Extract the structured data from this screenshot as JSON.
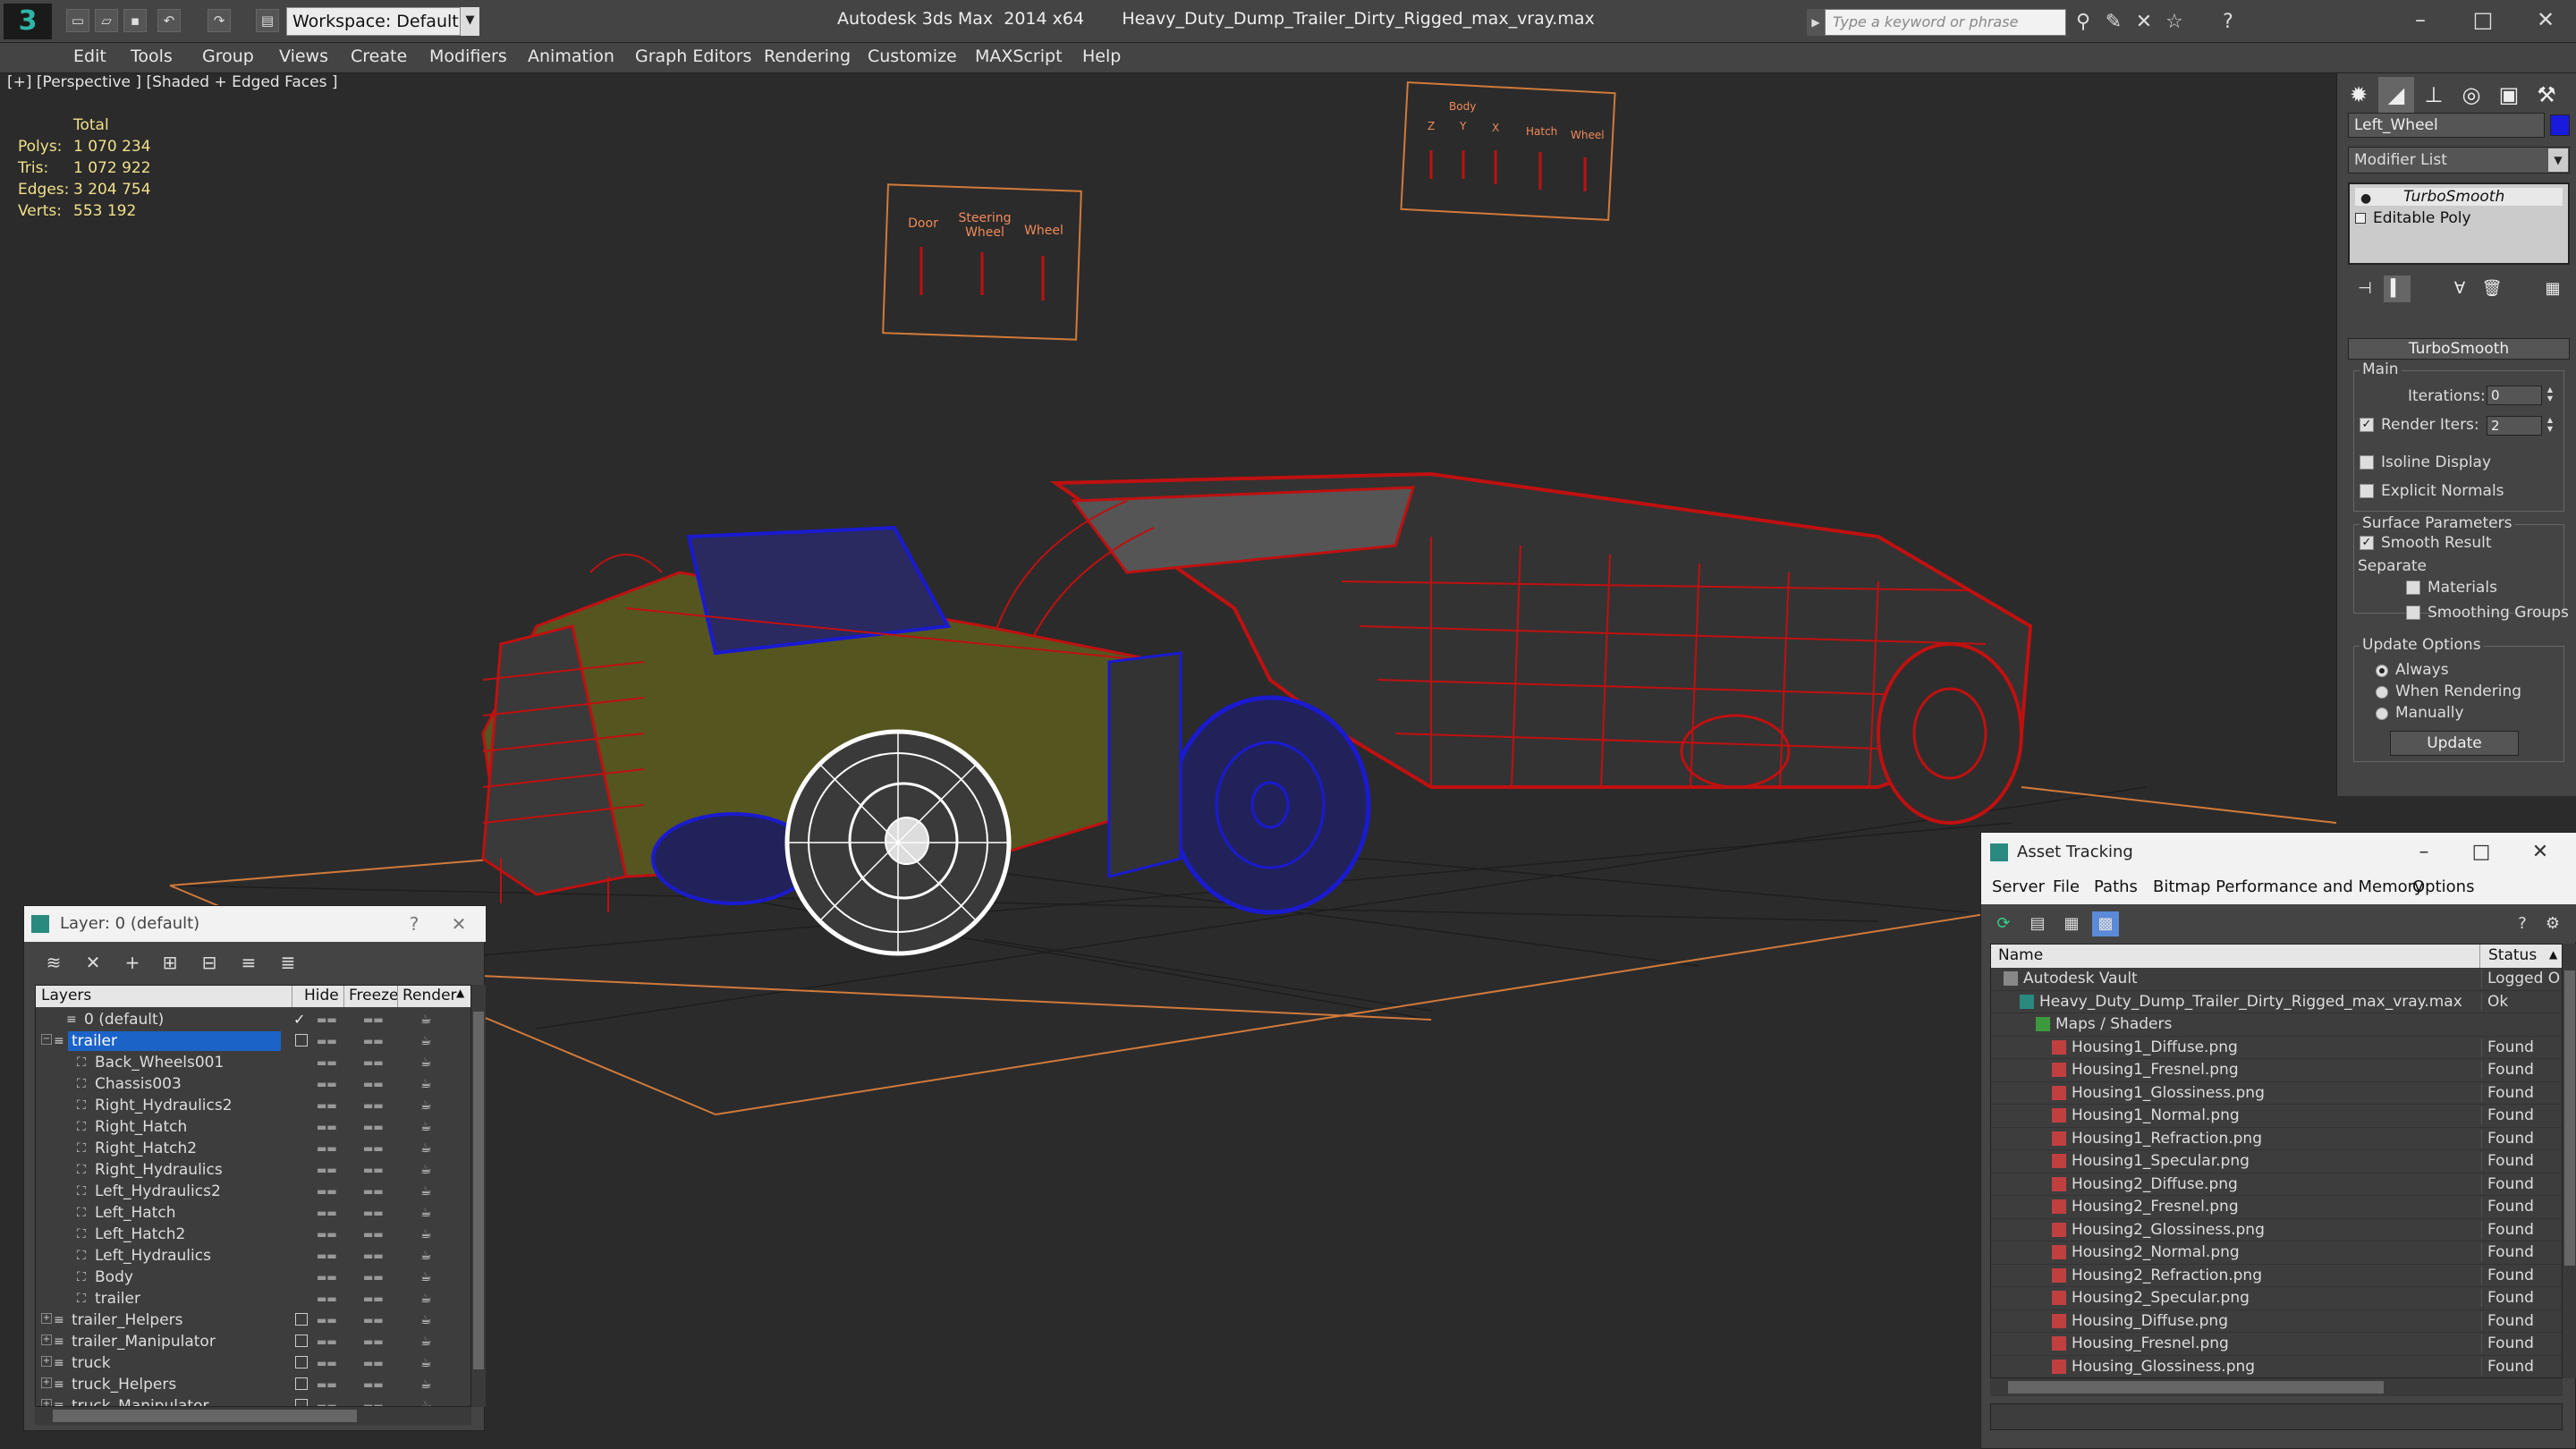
{
  "app": {
    "title": "Autodesk 3ds Max  2014 x64",
    "filename": "Heavy_Duty_Dump_Trailer_Dirty_Rigged_max_vray.max",
    "workspace": "Workspace: Default",
    "search_placeholder": "Type a keyword or phrase"
  },
  "menu": [
    "Edit",
    "Tools",
    "Group",
    "Views",
    "Create",
    "Modifiers",
    "Animation",
    "Graph Editors",
    "Rendering",
    "Customize",
    "MAXScript",
    "Help"
  ],
  "viewport": {
    "label": "[+] [Perspective ] [Shaded + Edged Faces ]",
    "stats": {
      "header": "Total",
      "rows": [
        {
          "label": "Polys:",
          "value": "1 070 234"
        },
        {
          "label": "Tris:",
          "value": "1 072 922"
        },
        {
          "label": "Edges:",
          "value": "3 204 754"
        },
        {
          "label": "Verts:",
          "value": "553 192"
        }
      ]
    },
    "manipulator_left": {
      "labels": [
        "Door",
        "Steering\nWheel",
        "Wheel"
      ]
    },
    "manipulator_right": {
      "group_label": "Body",
      "labels": [
        "Z",
        "Y",
        "X",
        "Hatch",
        "Wheel"
      ]
    }
  },
  "command_panel": {
    "object_name": "Left_Wheel",
    "object_color": "#1a1add",
    "modifier_list": "Modifier List",
    "stack": [
      "TurboSmooth",
      "Editable Poly"
    ],
    "rollout_title": "TurboSmooth",
    "main": {
      "title": "Main",
      "iterations_label": "Iterations:",
      "iterations_value": "0",
      "render_iters_label": "Render Iters:",
      "render_iters_value": "2",
      "isoline": "Isoline Display",
      "explicit_normals": "Explicit Normals"
    },
    "surface": {
      "title": "Surface Parameters",
      "smooth_result": "Smooth Result",
      "separate": "Separate",
      "materials": "Materials",
      "smoothing_groups": "Smoothing Groups"
    },
    "update": {
      "title": "Update Options",
      "always": "Always",
      "when_rendering": "When Rendering",
      "manually": "Manually",
      "button": "Update"
    }
  },
  "layer_panel": {
    "title": "Layer: 0 (default)",
    "help": "?",
    "columns": [
      "Layers",
      "Hide",
      "Freeze",
      "Render"
    ],
    "rows": [
      {
        "name": "0 (default)",
        "level": 1,
        "checked": true
      },
      {
        "name": "trailer",
        "level": 0,
        "selected": true,
        "box": true
      },
      {
        "name": "Back_Wheels001",
        "level": 2
      },
      {
        "name": "Chassis003",
        "level": 2
      },
      {
        "name": "Right_Hydraulics2",
        "level": 2
      },
      {
        "name": "Right_Hatch",
        "level": 2
      },
      {
        "name": "Right_Hatch2",
        "level": 2
      },
      {
        "name": "Right_Hydraulics",
        "level": 2
      },
      {
        "name": "Left_Hydraulics2",
        "level": 2
      },
      {
        "name": "Left_Hatch",
        "level": 2
      },
      {
        "name": "Left_Hatch2",
        "level": 2
      },
      {
        "name": "Left_Hydraulics",
        "level": 2
      },
      {
        "name": "Body",
        "level": 2
      },
      {
        "name": "trailer",
        "level": 2
      },
      {
        "name": "trailer_Helpers",
        "level": 0,
        "box": true
      },
      {
        "name": "trailer_Manipulator",
        "level": 0,
        "box": true
      },
      {
        "name": "truck",
        "level": 0,
        "box": true
      },
      {
        "name": "truck_Helpers",
        "level": 0,
        "box": true
      },
      {
        "name": "truck_Manipulator",
        "level": 0,
        "box": true
      }
    ]
  },
  "asset_panel": {
    "title": "Asset Tracking",
    "menu": [
      "Server",
      "File",
      "Paths",
      "Bitmap Performance and Memory",
      "Options"
    ],
    "columns": [
      "Name",
      "Status"
    ],
    "rows": [
      {
        "name": "Autodesk Vault",
        "status": "Logged O",
        "level": 0,
        "kind": "vault"
      },
      {
        "name": "Heavy_Duty_Dump_Trailer_Dirty_Rigged_max_vray.max",
        "status": "Ok",
        "level": 1,
        "kind": "max"
      },
      {
        "name": "Maps / Shaders",
        "status": "",
        "level": 2,
        "kind": "maps"
      },
      {
        "name": "Housing1_Diffuse.png",
        "status": "Found",
        "level": 3,
        "kind": "png"
      },
      {
        "name": "Housing1_Fresnel.png",
        "status": "Found",
        "level": 3,
        "kind": "png"
      },
      {
        "name": "Housing1_Glossiness.png",
        "status": "Found",
        "level": 3,
        "kind": "png"
      },
      {
        "name": "Housing1_Normal.png",
        "status": "Found",
        "level": 3,
        "kind": "png"
      },
      {
        "name": "Housing1_Refraction.png",
        "status": "Found",
        "level": 3,
        "kind": "png"
      },
      {
        "name": "Housing1_Specular.png",
        "status": "Found",
        "level": 3,
        "kind": "png"
      },
      {
        "name": "Housing2_Diffuse.png",
        "status": "Found",
        "level": 3,
        "kind": "png"
      },
      {
        "name": "Housing2_Fresnel.png",
        "status": "Found",
        "level": 3,
        "kind": "png"
      },
      {
        "name": "Housing2_Glossiness.png",
        "status": "Found",
        "level": 3,
        "kind": "png"
      },
      {
        "name": "Housing2_Normal.png",
        "status": "Found",
        "level": 3,
        "kind": "png"
      },
      {
        "name": "Housing2_Refraction.png",
        "status": "Found",
        "level": 3,
        "kind": "png"
      },
      {
        "name": "Housing2_Specular.png",
        "status": "Found",
        "level": 3,
        "kind": "png"
      },
      {
        "name": "Housing_Diffuse.png",
        "status": "Found",
        "level": 3,
        "kind": "png"
      },
      {
        "name": "Housing_Fresnel.png",
        "status": "Found",
        "level": 3,
        "kind": "png"
      },
      {
        "name": "Housing_Glossiness.png",
        "status": "Found",
        "level": 3,
        "kind": "png"
      }
    ]
  },
  "colors": {
    "wire_red": "#c01010",
    "wire_blue": "#1a1ad0",
    "wire_white": "#ffffff",
    "stats_yellow": "#f0e08a",
    "selection_blue": "#1c63c7",
    "grid_orange": "#d07a3a"
  }
}
